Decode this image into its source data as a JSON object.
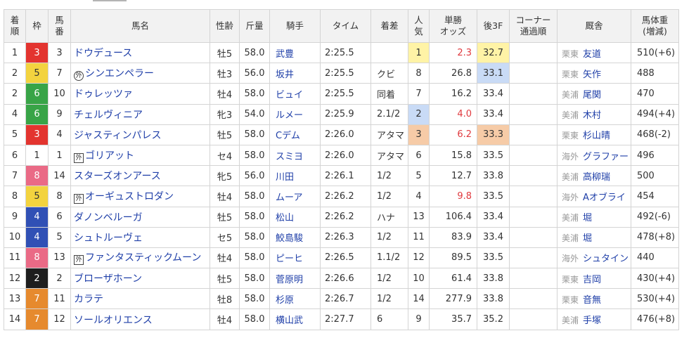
{
  "colors": {
    "header_bg": "#f2f2f2",
    "border": "#d4d4d4",
    "text": "#333333",
    "link": "#1f3fa8",
    "muted": "#999999",
    "odds_red": "#e0393e",
    "rank_1": "#fff3a6",
    "rank_2": "#c9dbf6",
    "rank_3": "#f6cba7"
  },
  "frame_colors": {
    "1": {
      "bg": "#ffffff",
      "fg": "#333333"
    },
    "2": {
      "bg": "#1e1e1e",
      "fg": "#ffffff"
    },
    "3": {
      "bg": "#e3342f",
      "fg": "#ffffff"
    },
    "4": {
      "bg": "#3050b5",
      "fg": "#ffffff"
    },
    "5": {
      "bg": "#f3d33f",
      "fg": "#333333"
    },
    "6": {
      "bg": "#38a447",
      "fg": "#ffffff"
    },
    "7": {
      "bg": "#e68a2e",
      "fg": "#ffffff"
    },
    "8": {
      "bg": "#ea6a86",
      "fg": "#ffffff"
    }
  },
  "headers": {
    "rank": [
      "着",
      "順"
    ],
    "frame": [
      "枠"
    ],
    "number": [
      "馬",
      "番"
    ],
    "name": [
      "馬名"
    ],
    "sex_age": [
      "性齢"
    ],
    "weight": [
      "斤量"
    ],
    "jockey": [
      "騎手"
    ],
    "time": [
      "タイム"
    ],
    "margin": [
      "着差"
    ],
    "popularity": [
      "人",
      "気"
    ],
    "odds": [
      "単勝",
      "オッズ"
    ],
    "last3f": [
      "後3F"
    ],
    "corner": [
      "コーナー",
      "通過順"
    ],
    "stable": [
      "厩舎"
    ],
    "body_weight": [
      "馬体重",
      "(増減)"
    ]
  },
  "rows": [
    {
      "rank": "1",
      "frame": "3",
      "number": "3",
      "name": "ドウデュース",
      "sex_age": "牡5",
      "weight": "58.0",
      "jockey": "武豊",
      "time": "2:25.5",
      "margin": "",
      "popularity": "1",
      "odds": "2.3",
      "last3f": "32.7",
      "stable_area": "栗東",
      "trainer": "友道",
      "body_weight": "510(+6)"
    },
    {
      "rank": "2",
      "frame": "5",
      "number": "7",
      "mark": "外",
      "mark_style": "circled",
      "name": "シンエンペラー",
      "sex_age": "牡3",
      "weight": "56.0",
      "jockey": "坂井",
      "time": "2:25.5",
      "margin": "クビ",
      "popularity": "8",
      "odds": "26.8",
      "last3f": "33.1",
      "stable_area": "栗東",
      "trainer": "矢作",
      "body_weight": "488"
    },
    {
      "rank": "2",
      "frame": "6",
      "number": "10",
      "name": "ドゥレッツァ",
      "sex_age": "牡4",
      "weight": "58.0",
      "jockey": "ビュイ",
      "time": "2:25.5",
      "margin": "同着",
      "popularity": "7",
      "odds": "16.2",
      "last3f": "33.4",
      "stable_area": "美浦",
      "trainer": "尾関",
      "body_weight": "470"
    },
    {
      "rank": "4",
      "frame": "6",
      "number": "9",
      "name": "チェルヴィニア",
      "sex_age": "牝3",
      "weight": "54.0",
      "jockey": "ルメー",
      "time": "2:25.9",
      "margin": "2.1/2",
      "popularity": "2",
      "odds": "4.0",
      "last3f": "33.4",
      "stable_area": "美浦",
      "trainer": "木村",
      "body_weight": "494(+4)"
    },
    {
      "rank": "5",
      "frame": "3",
      "number": "4",
      "name": "ジャスティンパレス",
      "sex_age": "牡5",
      "weight": "58.0",
      "jockey": "Cデム",
      "time": "2:26.0",
      "margin": "アタマ",
      "popularity": "3",
      "odds": "6.2",
      "last3f": "33.3",
      "stable_area": "栗東",
      "trainer": "杉山晴",
      "body_weight": "468(-2)"
    },
    {
      "rank": "6",
      "frame": "1",
      "number": "1",
      "mark": "外",
      "mark_style": "boxed",
      "name": "ゴリアット",
      "sex_age": "セ4",
      "weight": "58.0",
      "jockey": "スミヨ",
      "time": "2:26.0",
      "margin": "アタマ",
      "popularity": "6",
      "odds": "15.8",
      "last3f": "33.5",
      "stable_area": "海外",
      "trainer": "グラファー",
      "body_weight": "496"
    },
    {
      "rank": "7",
      "frame": "8",
      "number": "14",
      "name": "スターズオンアース",
      "sex_age": "牝5",
      "weight": "56.0",
      "jockey": "川田",
      "time": "2:26.1",
      "margin": "1/2",
      "popularity": "5",
      "odds": "12.7",
      "last3f": "33.8",
      "stable_area": "美浦",
      "trainer": "高柳瑞",
      "body_weight": "500"
    },
    {
      "rank": "8",
      "frame": "5",
      "number": "8",
      "mark": "外",
      "mark_style": "boxed",
      "name": "オーギュストロダン",
      "sex_age": "牡4",
      "weight": "58.0",
      "jockey": "ムーア",
      "time": "2:26.2",
      "margin": "1/2",
      "popularity": "4",
      "odds": "9.8",
      "last3f": "33.5",
      "stable_area": "海外",
      "trainer": "Aオブライ",
      "body_weight": "454"
    },
    {
      "rank": "9",
      "frame": "4",
      "number": "6",
      "name": "ダノンベルーガ",
      "sex_age": "牡5",
      "weight": "58.0",
      "jockey": "松山",
      "time": "2:26.2",
      "margin": "ハナ",
      "popularity": "13",
      "odds": "106.4",
      "last3f": "33.4",
      "stable_area": "美浦",
      "trainer": "堀",
      "body_weight": "492(-6)"
    },
    {
      "rank": "10",
      "frame": "4",
      "number": "5",
      "name": "シュトルーヴェ",
      "sex_age": "セ5",
      "weight": "58.0",
      "jockey": "鮫島駿",
      "time": "2:26.3",
      "margin": "1/2",
      "popularity": "11",
      "odds": "83.9",
      "last3f": "33.4",
      "stable_area": "美浦",
      "trainer": "堀",
      "body_weight": "478(+8)"
    },
    {
      "rank": "11",
      "frame": "8",
      "number": "13",
      "mark": "外",
      "mark_style": "boxed",
      "name": "ファンタスティックムーン",
      "sex_age": "牡4",
      "weight": "58.0",
      "jockey": "ピーヒ",
      "time": "2:26.5",
      "margin": "1.1/2",
      "popularity": "12",
      "odds": "89.5",
      "last3f": "33.5",
      "stable_area": "海外",
      "trainer": "シュタイン",
      "body_weight": "440"
    },
    {
      "rank": "12",
      "frame": "2",
      "number": "2",
      "name": "ブローザホーン",
      "sex_age": "牡5",
      "weight": "58.0",
      "jockey": "菅原明",
      "time": "2:26.6",
      "margin": "1/2",
      "popularity": "10",
      "odds": "61.4",
      "last3f": "33.8",
      "stable_area": "栗東",
      "trainer": "吉岡",
      "body_weight": "430(+4)"
    },
    {
      "rank": "13",
      "frame": "7",
      "number": "11",
      "name": "カラテ",
      "sex_age": "牡8",
      "weight": "58.0",
      "jockey": "杉原",
      "time": "2:26.7",
      "margin": "1/2",
      "popularity": "14",
      "odds": "277.9",
      "last3f": "33.8",
      "stable_area": "栗東",
      "trainer": "音無",
      "body_weight": "530(+4)"
    },
    {
      "rank": "14",
      "frame": "7",
      "number": "12",
      "name": "ソールオリエンス",
      "sex_age": "牡4",
      "weight": "58.0",
      "jockey": "横山武",
      "time": "2:27.7",
      "margin": "6",
      "popularity": "9",
      "odds": "35.7",
      "last3f": "35.2",
      "stable_area": "美浦",
      "trainer": "手塚",
      "body_weight": "476(+8)"
    }
  ]
}
